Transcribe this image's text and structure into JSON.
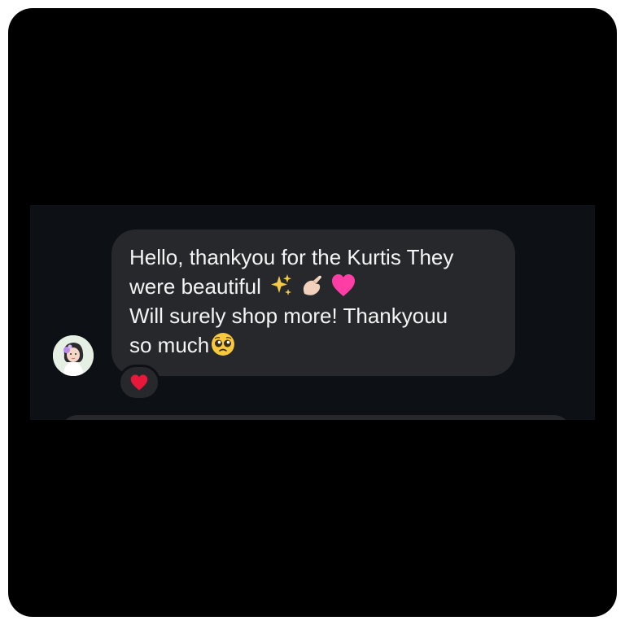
{
  "message": {
    "line1": "Hello, thankyou for the Kurtis They",
    "line2_text": "were beautiful ",
    "line3": "Will surely shop more! Thankyouu",
    "line4_text": "so much"
  },
  "emojis": [
    "sparkles",
    "pinching-hand",
    "pink-heart",
    "pleading-face"
  ],
  "reaction": {
    "emoji": "red-heart"
  },
  "colors": {
    "background": "#000000",
    "chat_background": "#0d1014",
    "bubble": "#26282c",
    "text": "#f4f4f5",
    "heart": "#e8183a",
    "pink_heart": "#ff3ea5"
  }
}
